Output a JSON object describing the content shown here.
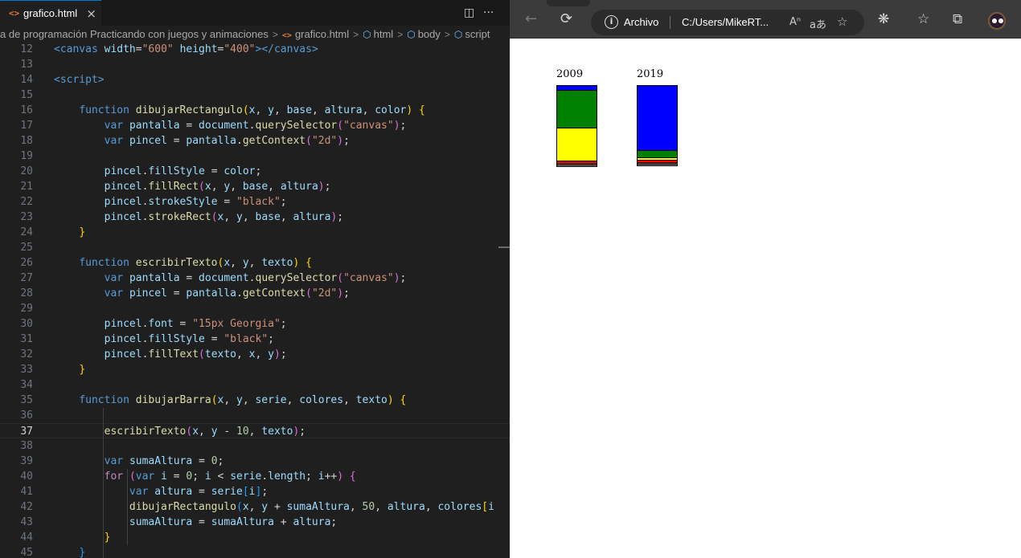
{
  "editor": {
    "tab": {
      "icon": "html-file-icon",
      "label": "grafico.html",
      "close": "×"
    },
    "actions": {
      "split": "split-editor-icon",
      "more": "···"
    },
    "breadcrumb": {
      "folder": "a de programación Practicando con juegos y animaciones",
      "file": "grafico.html",
      "items": [
        "html",
        "body",
        "script"
      ]
    },
    "lines": [
      {
        "num": "12",
        "text": "    <canvas width=\"600\" height=\"400\"></canvas>"
      },
      {
        "num": "13",
        "text": ""
      },
      {
        "num": "14",
        "text": "    <script>"
      },
      {
        "num": "15",
        "text": ""
      },
      {
        "num": "16",
        "text": "        function dibujarRectangulo(x, y, base, altura, color) {"
      },
      {
        "num": "17",
        "text": "            var pantalla = document.querySelector(\"canvas\");"
      },
      {
        "num": "18",
        "text": "            var pincel = pantalla.getContext(\"2d\");"
      },
      {
        "num": "19",
        "text": ""
      },
      {
        "num": "20",
        "text": "            pincel.fillStyle = color;"
      },
      {
        "num": "21",
        "text": "            pincel.fillRect(x, y, base, altura);"
      },
      {
        "num": "22",
        "text": "            pincel.strokeStyle = \"black\";"
      },
      {
        "num": "23",
        "text": "            pincel.strokeRect(x, y, base, altura);"
      },
      {
        "num": "24",
        "text": "        }"
      },
      {
        "num": "25",
        "text": ""
      },
      {
        "num": "26",
        "text": "        function escribirTexto(x, y, texto) {"
      },
      {
        "num": "27",
        "text": "            var pantalla = document.querySelector(\"canvas\");"
      },
      {
        "num": "28",
        "text": "            var pincel = pantalla.getContext(\"2d\");"
      },
      {
        "num": "29",
        "text": ""
      },
      {
        "num": "30",
        "text": "            pincel.font = \"15px Georgia\";"
      },
      {
        "num": "31",
        "text": "            pincel.fillStyle = \"black\";"
      },
      {
        "num": "32",
        "text": "            pincel.fillText(texto, x, y);"
      },
      {
        "num": "33",
        "text": "        }"
      },
      {
        "num": "34",
        "text": ""
      },
      {
        "num": "35",
        "text": "        function dibujarBarra(x, y, serie, colores, texto) {"
      },
      {
        "num": "36",
        "text": ""
      },
      {
        "num": "37",
        "text": "            escribirTexto(x, y - 10, texto);"
      },
      {
        "num": "38",
        "text": ""
      },
      {
        "num": "39",
        "text": "            var sumaAltura = 0;"
      },
      {
        "num": "40",
        "text": "            for (var i = 0; i < serie.length; i++) {"
      },
      {
        "num": "41",
        "text": "                var altura = serie[i];"
      },
      {
        "num": "42",
        "text": "                dibujarRectangulo(x, y + sumaAltura, 50, altura, colores[i"
      },
      {
        "num": "43",
        "text": "                sumaAltura = sumaAltura + altura;"
      },
      {
        "num": "44",
        "text": "            }"
      },
      {
        "num": "45",
        "text": "        }"
      }
    ],
    "current_line": "37"
  },
  "browser": {
    "back": "←",
    "refresh": "⟳",
    "address": {
      "security_label": "Archivo",
      "url": "C:/Users/MikeRT..."
    },
    "icons": [
      "read-aloud-icon",
      "translate-icon",
      "add-favorite-icon",
      "extensions-icon",
      "favorites-icon",
      "collections-icon",
      "profile-avatar"
    ],
    "bars": [
      {
        "label": "2009",
        "segments": [
          {
            "value": 6,
            "color": "#0000ff"
          },
          {
            "value": 47,
            "color": "#008000"
          },
          {
            "value": 41,
            "color": "#ffff00"
          },
          {
            "value": 3,
            "color": "#ff0000"
          },
          {
            "value": 2,
            "color": "#8b4513"
          },
          {
            "value": 2,
            "color": "#808080"
          }
        ]
      },
      {
        "label": "2019",
        "segments": [
          {
            "value": 81,
            "color": "#0000ff"
          },
          {
            "value": 9,
            "color": "#008000"
          },
          {
            "value": 3,
            "color": "#ffff00"
          },
          {
            "value": 3,
            "color": "#ff0000"
          },
          {
            "value": 2,
            "color": "#8b4513"
          },
          {
            "value": 2,
            "color": "#808080"
          }
        ]
      }
    ]
  }
}
